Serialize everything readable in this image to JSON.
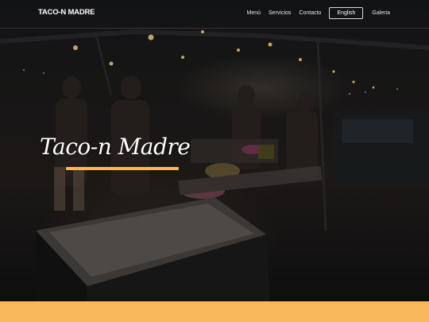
{
  "nav": {
    "brand": "TACO-N MADRE",
    "links": [
      "Menú",
      "Servicios",
      "Contacto"
    ],
    "language_button": "English",
    "gallery": "Galeria"
  },
  "hero": {
    "title": "Taco-n Madre"
  },
  "colors": {
    "accent": "#f5b94e",
    "band": "#f9b85a",
    "background": "#0c0d10"
  }
}
